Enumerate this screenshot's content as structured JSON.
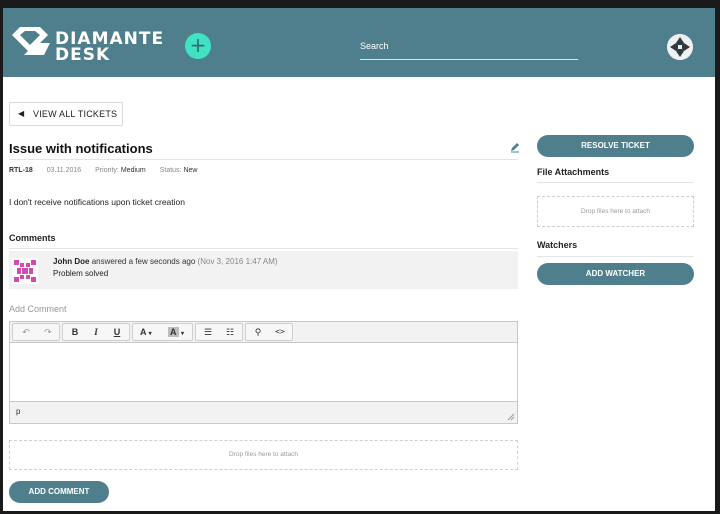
{
  "header": {
    "logo_line1": "DIAMANTE",
    "logo_line2": "DESK",
    "add_icon": "plus-icon",
    "search_placeholder": "Search",
    "accent_color": "#4f7f8c",
    "add_color": "#3fe3c4"
  },
  "nav": {
    "back_label": "VIEW ALL TICKETS",
    "back_icon": "chevron-left-icon"
  },
  "ticket": {
    "title": "Issue with notifications",
    "key": "RTL-18",
    "date": "03.11.2016",
    "priority_label": "Priority:",
    "priority": "Medium",
    "status_label": "Status:",
    "status": "New",
    "description": "I don't receive notifications upon ticket creation"
  },
  "comments": {
    "heading": "Comments",
    "items": [
      {
        "author": "John Doe",
        "action": "answered a few seconds ago",
        "timestamp": "(Nov 3, 2016 1:47 AM)",
        "body": "Problem solved"
      }
    ]
  },
  "editor": {
    "label": "Add Comment",
    "toolbar": [
      "undo-icon",
      "redo-icon",
      "bold-icon",
      "italic-icon",
      "underline-icon",
      "text-color-icon",
      "background-color-icon",
      "bullet-list-icon",
      "numbered-list-icon",
      "link-icon",
      "code-icon"
    ],
    "path": "p",
    "drop_text": "Drop files here to attach",
    "submit_label": "ADD COMMENT"
  },
  "sidebar": {
    "resolve_label": "RESOLVE TICKET",
    "attachments_heading": "File Attachments",
    "drop_text": "Drop files here to attach",
    "watchers_heading": "Watchers",
    "add_watcher_label": "ADD WATCHER"
  }
}
